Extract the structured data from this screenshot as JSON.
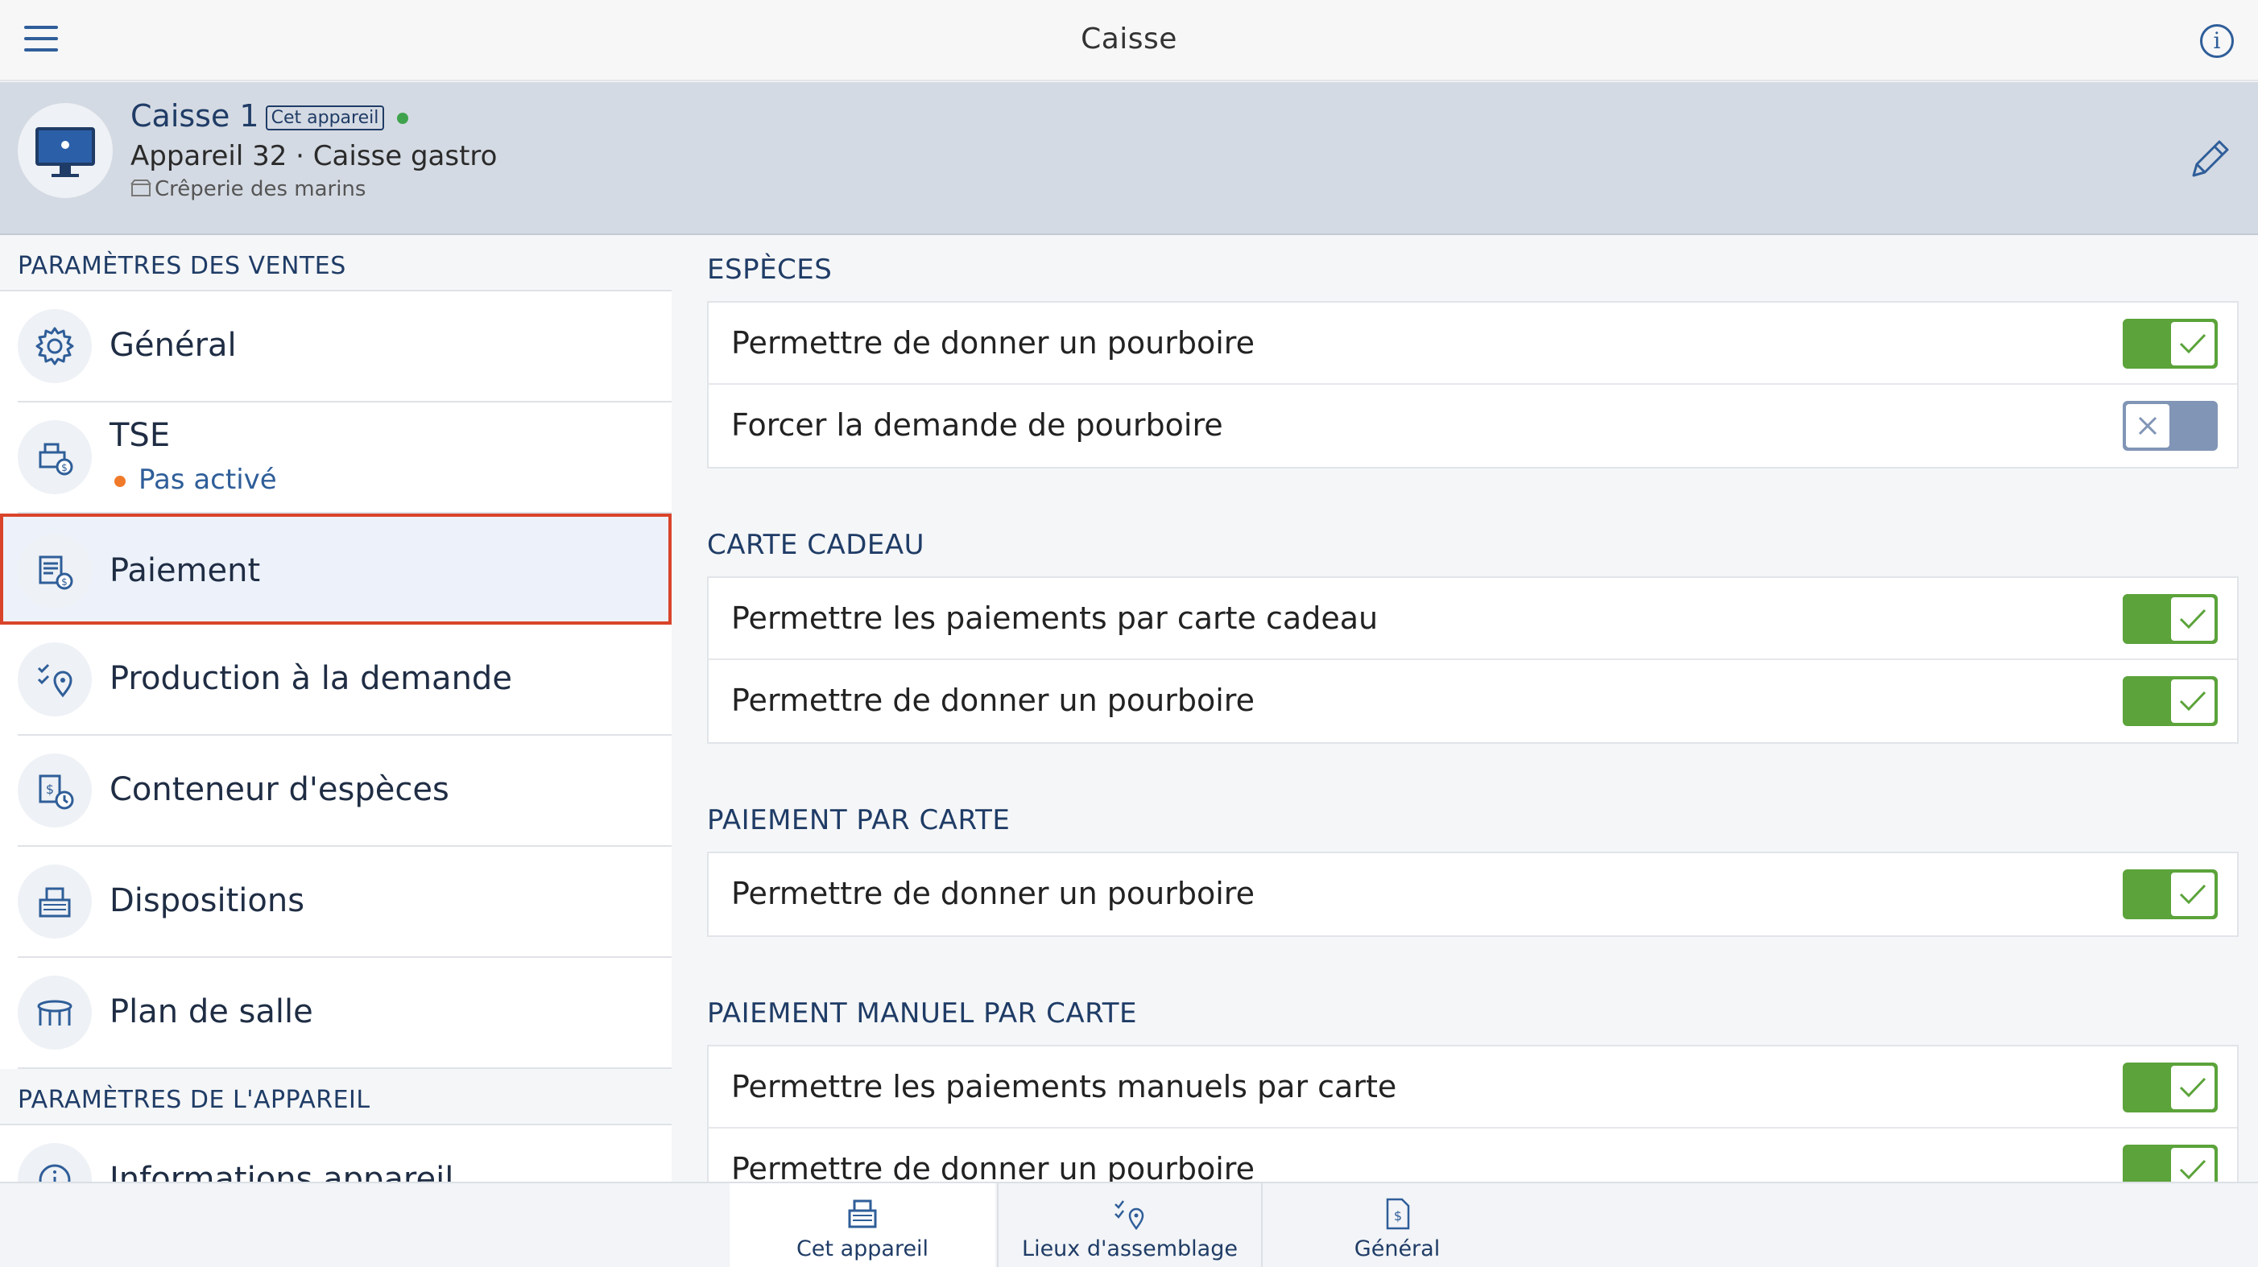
{
  "topbar": {
    "title": "Caisse",
    "menu_icon": "hamburger-icon",
    "info_icon": "info-icon"
  },
  "device": {
    "name": "Caisse 1",
    "badge": "Cet appareil",
    "status_color": "#3fa34d",
    "subtitle": "Appareil 32 · Caisse gastro",
    "location": "Crêperie des marins"
  },
  "sidebar": {
    "section_sales": "PARAMÈTRES DES VENTES",
    "section_device": "PARAMÈTRES DE L'APPAREIL",
    "items": [
      {
        "label": "Général",
        "icon": "gear-icon"
      },
      {
        "label": "TSE",
        "sub": "Pas activé",
        "icon": "cash-register-icon"
      },
      {
        "label": "Paiement",
        "icon": "payment-icon"
      },
      {
        "label": "Production à la demande",
        "icon": "checklist-location-icon"
      },
      {
        "label": "Conteneur d'espèces",
        "icon": "cash-container-icon"
      },
      {
        "label": "Dispositions",
        "icon": "register-layout-icon"
      },
      {
        "label": "Plan de salle",
        "icon": "table-icon"
      },
      {
        "label": "Informations appareil",
        "icon": "info-icon"
      }
    ]
  },
  "main": {
    "sections": [
      {
        "title": "ESPÈCES",
        "rows": [
          {
            "label": "Permettre de donner un pourboire",
            "on": true
          },
          {
            "label": "Forcer la demande de pourboire",
            "on": false
          }
        ]
      },
      {
        "title": "CARTE CADEAU",
        "rows": [
          {
            "label": "Permettre les paiements par carte cadeau",
            "on": true
          },
          {
            "label": "Permettre de donner un pourboire",
            "on": true
          }
        ]
      },
      {
        "title": "PAIEMENT PAR CARTE",
        "rows": [
          {
            "label": "Permettre de donner un pourboire",
            "on": true
          }
        ]
      },
      {
        "title": "PAIEMENT MANUEL PAR CARTE",
        "rows": [
          {
            "label": "Permettre les paiements manuels par carte",
            "on": true
          },
          {
            "label": "Permettre de donner un pourboire",
            "on": true
          }
        ]
      }
    ]
  },
  "tabs": [
    {
      "label": "Cet appareil",
      "active": true
    },
    {
      "label": "Lieux d'assemblage",
      "active": false
    },
    {
      "label": "Général",
      "active": false
    }
  ],
  "colors": {
    "accent": "#2f5e99",
    "toggle_on": "#5ba33a",
    "toggle_off": "#8195b6",
    "selection": "#d9442b"
  }
}
